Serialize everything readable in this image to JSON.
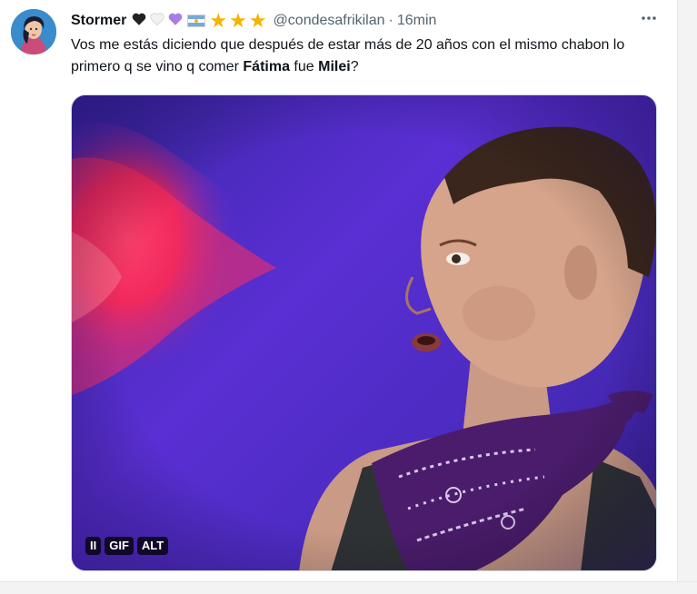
{
  "tweet": {
    "display_name": "Stormer",
    "badges": [
      {
        "icon": "black-heart-icon",
        "color": "#222222"
      },
      {
        "icon": "white-heart-icon",
        "color": "#f2f2f2"
      },
      {
        "icon": "purple-heart-icon",
        "color": "#a77de6"
      },
      {
        "icon": "argentina-flag-icon"
      },
      {
        "icon": "star-icon",
        "color": "#f4b400"
      },
      {
        "icon": "star-icon",
        "color": "#f4b400"
      },
      {
        "icon": "star-icon",
        "color": "#f4b400"
      }
    ],
    "handle": "@condesafrikilan",
    "separator": "·",
    "time": "16min",
    "more_icon": "more-options-icon",
    "text_part1": "Vos me estás diciendo que después de estar más de 20 años con el mismo chabon lo primero q se vino q comer ",
    "text_bold1": "Fátima",
    "text_part2": " fue ",
    "text_bold2": "Milei",
    "text_part3": "?"
  },
  "media": {
    "type": "gif",
    "controls": {
      "pause_label": "II",
      "gif_label": "GIF",
      "alt_label": "ALT"
    }
  },
  "colors": {
    "text": "#0f1419",
    "secondary": "#536471",
    "media_bg": "#4a2bbf",
    "neon": "#ff3b6b"
  }
}
